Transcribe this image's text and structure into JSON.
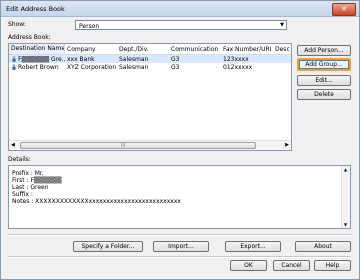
{
  "window": {
    "title": "Edit Address Book",
    "close_symbol": "✕"
  },
  "show": {
    "label": "Show:",
    "value": "Person"
  },
  "address_book": {
    "label": "Address Book:",
    "columns": [
      "Destination Name",
      "Company",
      "Dept./Div.",
      "Communication ...",
      "Fax Number/URI",
      "Desc"
    ],
    "rows": [
      {
        "name": "F▒▒▒▒▒▒ Gre...",
        "company": "xxx Bank",
        "dept": "Salesman",
        "comm": "G3",
        "fax": "123xxxx",
        "selected": true
      },
      {
        "name": "Robert Brown",
        "company": "XYZ Corporation",
        "dept": "Salesman",
        "comm": "G3",
        "fax": "012xxxxx",
        "selected": false
      }
    ]
  },
  "side_buttons": {
    "add_person": "Add Person...",
    "add_group": "Add Group...",
    "edit": "Edit...",
    "delete": "Delete"
  },
  "details": {
    "label": "Details:",
    "lines": [
      "Prefix : Mr.",
      "First : F▒▒▒▒▒▒",
      "Last : Green",
      "Suffix :",
      "Notes : XXXXXXXXXXXXXxxxxxxxxxxxxxxxxxxxxxxxxxx"
    ]
  },
  "bottom_buttons": {
    "specify_folder": "Specify a Folder...",
    "import": "Import...",
    "export": "Export...",
    "about": "About"
  },
  "dialog_buttons": {
    "ok": "OK",
    "cancel": "Cancel",
    "help": "Help"
  },
  "colors": {
    "focus_ring": "#f0a030",
    "selection": "#d9e8fb"
  }
}
